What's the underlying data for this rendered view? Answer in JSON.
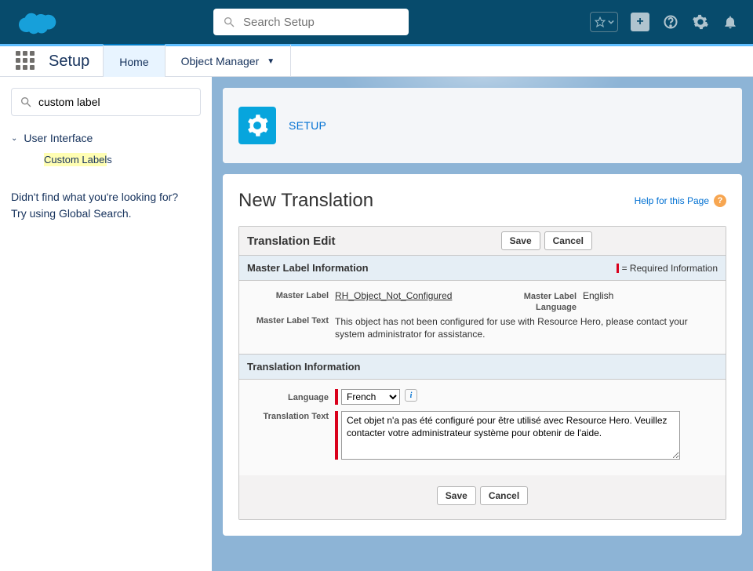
{
  "header": {
    "search_placeholder": "Search Setup"
  },
  "nav": {
    "setup_label": "Setup",
    "tabs": [
      {
        "label": "Home",
        "active": true
      },
      {
        "label": "Object Manager",
        "active": false
      }
    ]
  },
  "sidebar": {
    "filter_value": "custom label",
    "sections": [
      {
        "label": "User Interface",
        "leaf": "Custom Labels",
        "highlight": "Custom Label"
      }
    ],
    "help_line1": "Didn't find what you're looking for?",
    "help_line2": "Try using Global Search."
  },
  "page": {
    "header_eyebrow": "SETUP",
    "title": "New Translation",
    "help_link": "Help for this Page",
    "block_title": "Translation Edit",
    "save_label": "Save",
    "cancel_label": "Cancel",
    "section1_title": "Master Label Information",
    "required_info": "= Required Information",
    "master_label_label": "Master Label",
    "master_label_value": "RH_Object_Not_Configured",
    "master_lang_label": "Master Label Language",
    "master_lang_value": "English",
    "master_text_label": "Master Label Text",
    "master_text_value": "This object has not been configured for use with Resource Hero, please contact your system administrator for assistance.",
    "section2_title": "Translation Information",
    "language_label": "Language",
    "language_value": "French",
    "translation_text_label": "Translation Text",
    "translation_text_value": "Cet objet n'a pas été configuré pour être utilisé avec Resource Hero. Veuillez contacter votre administrateur système pour obtenir de l'aide."
  }
}
